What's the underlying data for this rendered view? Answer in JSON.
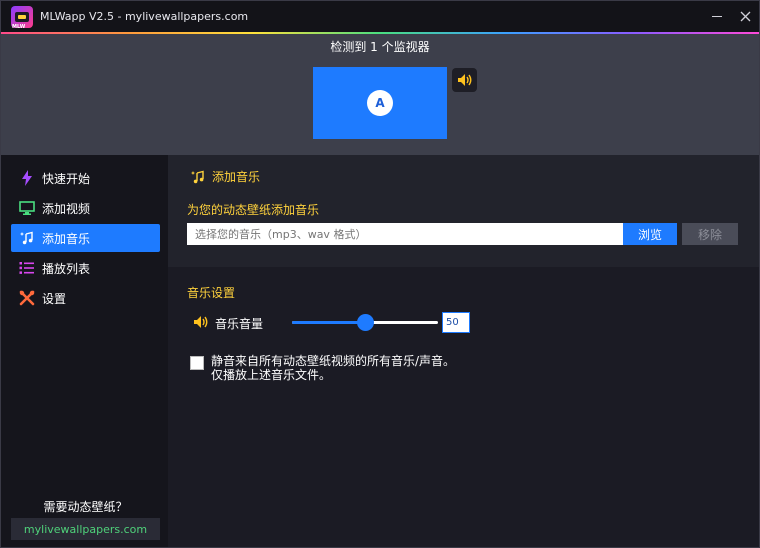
{
  "window": {
    "title": "MLWapp V2.5 - mylivewallpapers.com",
    "logo_tag": "MLW"
  },
  "monitor": {
    "detected_text": "检测到 1 个监视器",
    "monitors": [
      {
        "letter": "A"
      }
    ],
    "accent_color": "#1e7bff"
  },
  "sidebar": {
    "items": [
      {
        "label": "快速开始",
        "icon": "lightning-icon",
        "color": "#a64dff"
      },
      {
        "label": "添加视频",
        "icon": "monitor-icon",
        "color": "#4ade80"
      },
      {
        "label": "添加音乐",
        "icon": "music-sparkle-icon",
        "color": "#ffffff",
        "active": true
      },
      {
        "label": "播放列表",
        "icon": "list-icon",
        "color": "#d946ef"
      },
      {
        "label": "设置",
        "icon": "tools-icon",
        "color": "#ff6a3c"
      }
    ],
    "need_text": "需要动态壁纸？",
    "site_link": "mylivewallpapers.com"
  },
  "main": {
    "section_title": "添加音乐",
    "add_music_title": "为您的动态壁纸添加音乐",
    "music_input": {
      "value": "",
      "placeholder": "选择您的音乐（mp3、wav 格式）"
    },
    "browse_label": "浏览",
    "remove_label": "移除",
    "settings_title": "音乐设置",
    "volume_label": "音乐音量",
    "volume_value": "50",
    "volume_fraction": 0.5,
    "mute_checked": false,
    "mute_line1": "静音来自所有动态壁纸视频的所有音乐/声音。",
    "mute_line2": "仅播放上述音乐文件。"
  },
  "colors": {
    "accent": "#1e7bff",
    "heading": "#ffd23c",
    "link": "#4fd17a"
  }
}
